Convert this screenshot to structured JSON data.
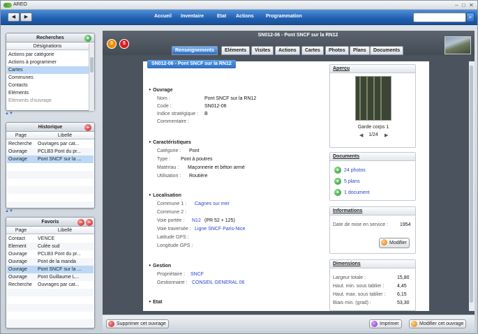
{
  "app": {
    "title": "AREO",
    "window_controls": [
      "–",
      "□",
      "✕"
    ]
  },
  "nav": {
    "back": "◀",
    "forward": "▶",
    "items": [
      "Accueil",
      "Inventaire",
      "Etat",
      "Actions",
      "Programmation"
    ],
    "search_placeholder": "",
    "search_icon": "search-icon"
  },
  "recherches": {
    "title": "Recherches",
    "column": "Désignations",
    "items": [
      "Actions par catégorie",
      "Actions à programmer",
      "Cartes",
      "Communes",
      "Contacts",
      "Eléments",
      "Eléments d'ouvrage"
    ],
    "selected_index": 2
  },
  "historique": {
    "title": "Historique",
    "columns": [
      "Page",
      "Libellé"
    ],
    "rows": [
      [
        "Recherche",
        "Ouvrages par cat..."
      ],
      [
        "Ouvrage",
        "PCLB3 Pont du pr..."
      ],
      [
        "Ouvrage",
        "Pont SNCF sur la ..."
      ]
    ],
    "selected_index": 2
  },
  "favoris": {
    "title": "Favoris",
    "columns": [
      "Page",
      "Libellé"
    ],
    "rows": [
      [
        "Contact",
        "VENCE"
      ],
      [
        "Element",
        "Culée sud"
      ],
      [
        "Ouvrage",
        "PCLB3 Pont du pr..."
      ],
      [
        "Ouvrage",
        "Pont de la manda"
      ],
      [
        "Ouvrage",
        "Pont SNCF sur la ..."
      ],
      [
        "Ouvrage",
        "Pont Guillaume L..."
      ],
      [
        "Recherche",
        "Ouvrages par cat..."
      ]
    ],
    "selected_index": 4
  },
  "record": {
    "breadcrumb": "SN012-06 - Pont SNCF sur la RN12",
    "badge_left": "0",
    "badge_right": "5",
    "tabs": [
      "Renseignements",
      "Eléments",
      "Visites",
      "Actions",
      "Cartes",
      "Photos",
      "Plans",
      "Documents"
    ],
    "active_tab": 0,
    "banner": "SN012-06 - Pont SNCF sur la RN12"
  },
  "ouvrage": {
    "heading": "Ouvrage",
    "nom_label": "Nom :",
    "nom": "Pont SNCF sur la RN12",
    "code_label": "Code :",
    "code": "SN012-06",
    "indice_label": "Indice stratégique :",
    "indice": "B",
    "commentaire_label": "Commentaire :"
  },
  "caracteristiques": {
    "heading": "Caractéristiques",
    "categorie_label": "Catégorie :",
    "categorie": "Pont",
    "type_label": "Type :",
    "type": "Pont à poutres",
    "materiau_label": "Matériau :",
    "materiau": "Maçonnerie et béton armé",
    "utilisation_label": "Utilisation :",
    "utilisation": "Routière"
  },
  "localisation": {
    "heading": "Localisation",
    "commune1_label": "Commune 1 :",
    "commune1": "Cagnes sur mer",
    "commune2_label": "Commune 2 :",
    "voie_portee_label": "Voie portée :",
    "voie_portee": "N12",
    "voie_portee_pr": "(PR 52 + 125)",
    "voie_traversee_label": "Voie traversée :",
    "voie_traversee": "Ligne SNCF Paris-Nice",
    "latitude_label": "Latitude GPS :",
    "longitude_label": "Longitude GPS :"
  },
  "gestion": {
    "heading": "Gestion",
    "proprietaire_label": "Propriétaire :",
    "proprietaire": "SNCF",
    "gestionnaire_label": "Gestionnaire :",
    "gestionnaire": "CONSEIL GENERAL 06"
  },
  "etat": {
    "heading": "Etat"
  },
  "apercu": {
    "heading": "Aperçu",
    "caption": "Garde corps 1",
    "counter": "1/24",
    "prev": "◀",
    "next": "▶"
  },
  "documents": {
    "heading": "Documents",
    "items": [
      "24 photos",
      "5 plans",
      "1 document"
    ]
  },
  "informations": {
    "heading": "Informations",
    "date_label": "Date de mise en service :",
    "date": "1954",
    "modifier": "Modifier"
  },
  "dimensions": {
    "heading": "Dimensions",
    "rows": [
      [
        "Largeur totale :",
        "15,80"
      ],
      [
        "Haut. min. sous tablier :",
        "4,45"
      ],
      [
        "Haut. max. sous tablier :",
        "6,15"
      ],
      [
        "Biais min. (grad) :",
        "53,30"
      ]
    ]
  },
  "bottom": {
    "delete": "Supprimer cet ouvrage",
    "print": "Imprimer",
    "edit": "Modifier cet ouvrage"
  }
}
